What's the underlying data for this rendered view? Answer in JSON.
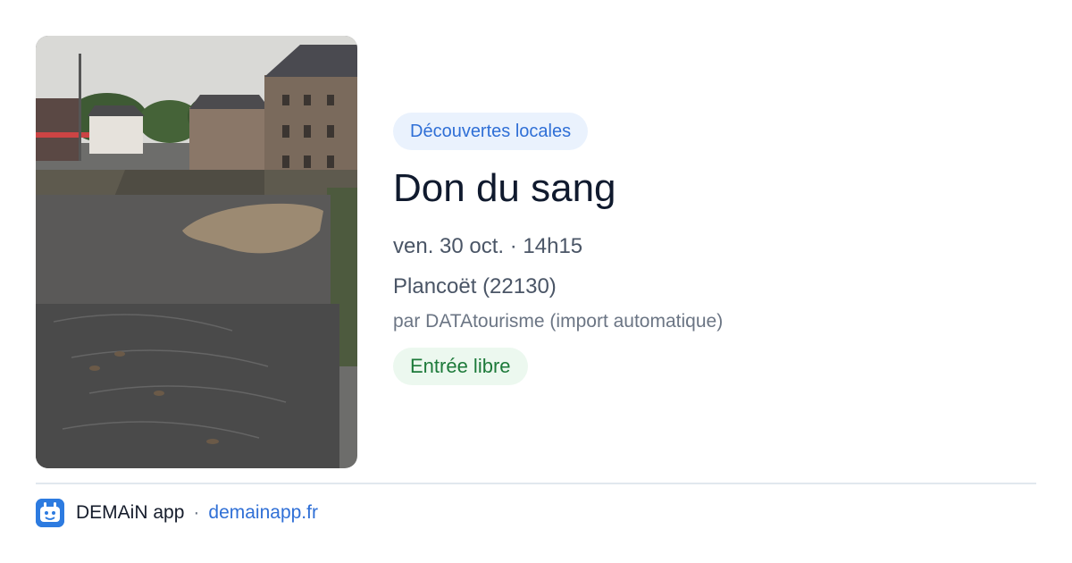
{
  "event": {
    "category": "Découvertes locales",
    "title": "Don du sang",
    "datetime": "ven. 30 oct. · 14h15",
    "location": "Plancoët (22130)",
    "source": "par DATAtourisme (import automatique)",
    "price": "Entrée libre"
  },
  "footer": {
    "app_name": "DEMAiN app",
    "separator": "·",
    "site": "demainapp.fr"
  },
  "colors": {
    "accent": "#2f6fd6",
    "category_bg": "#eaf2fd",
    "price_text": "#1d7a3a",
    "price_bg": "#ecf8ef",
    "logo": "#2d7be0"
  },
  "icons": {
    "app_logo": "demain-logo-icon"
  }
}
